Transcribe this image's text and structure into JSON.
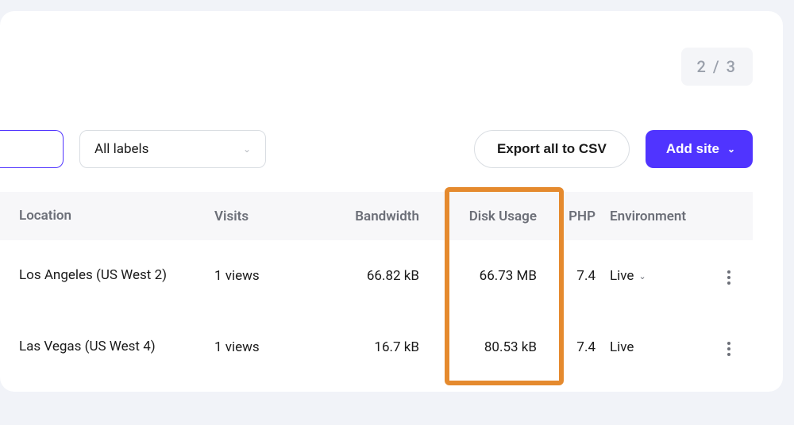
{
  "pagination": {
    "current": 2,
    "total": 3,
    "display": "2 / 3"
  },
  "toolbar": {
    "labels_dropdown": "All labels",
    "export": "Export all to CSV",
    "add_site": "Add site"
  },
  "table": {
    "headers": {
      "location": "Location",
      "visits": "Visits",
      "bandwidth": "Bandwidth",
      "disk": "Disk Usage",
      "php": "PHP",
      "env": "Environment"
    },
    "rows": [
      {
        "location": "Los Angeles (US West 2)",
        "visits": "1 views",
        "bandwidth": "66.82 kB",
        "disk": "66.73 MB",
        "php": "7.4",
        "env": "Live",
        "env_dropdown": true
      },
      {
        "location": "Las Vegas (US West 4)",
        "visits": "1 views",
        "bandwidth": "16.7 kB",
        "disk": "80.53 kB",
        "php": "7.4",
        "env": "Live",
        "env_dropdown": false
      }
    ]
  },
  "highlight": {
    "column": "disk"
  }
}
